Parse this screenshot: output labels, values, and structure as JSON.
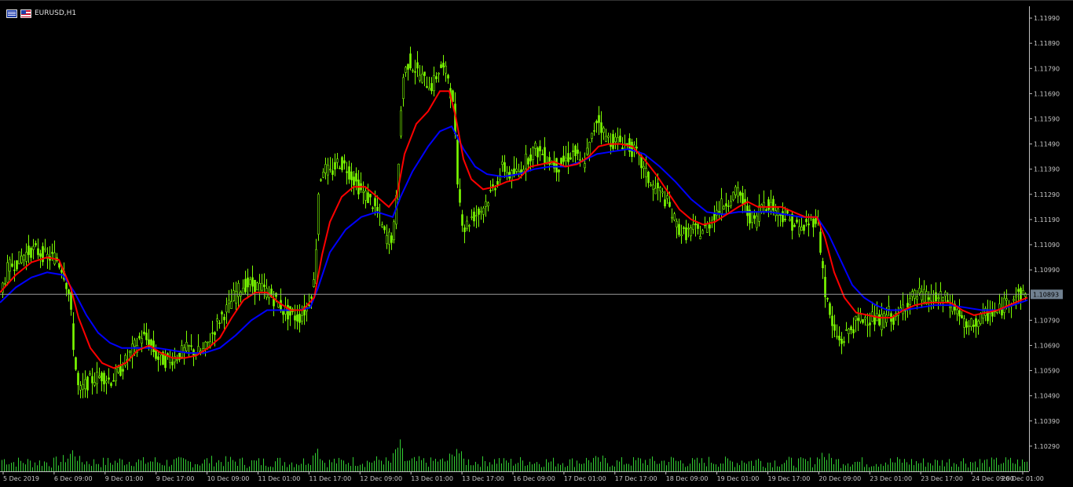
{
  "window": {
    "title": "EURUSD,H1"
  },
  "colors": {
    "background": "#000000",
    "candle": "#7CFC00",
    "ma_fast": "#FF0000",
    "ma_slow": "#0000FF",
    "volume": "#32CD32",
    "grid_line": "#C0C0C0",
    "price_tag": "#708090"
  },
  "chart_data": {
    "type": "candlestick",
    "symbol": "EURUSD",
    "timeframe": "H1",
    "ylim": [
      1.1019,
      1.1204
    ],
    "y_ticks": [
      "1.11990",
      "1.11890",
      "1.11790",
      "1.11690",
      "1.11590",
      "1.11490",
      "1.11390",
      "1.11290",
      "1.11190",
      "1.11090",
      "1.10990",
      "1.10790",
      "1.10690",
      "1.10590",
      "1.10490",
      "1.10390",
      "1.10290"
    ],
    "x_ticks": [
      "5 Dec 2019",
      "6 Dec 09:00",
      "9 Dec 01:00",
      "9 Dec 17:00",
      "10 Dec 09:00",
      "11 Dec 01:00",
      "11 Dec 17:00",
      "12 Dec 09:00",
      "13 Dec 01:00",
      "13 Dec 17:00",
      "16 Dec 09:00",
      "17 Dec 01:00",
      "17 Dec 17:00",
      "18 Dec 09:00",
      "19 Dec 01:00",
      "19 Dec 17:00",
      "20 Dec 09:00",
      "23 Dec 01:00",
      "23 Dec 17:00",
      "24 Dec 09:00",
      "26 Dec 01:00"
    ],
    "current_price": "1.10893",
    "current_price_value": 1.10893,
    "close_path": [
      [
        0,
        1.109
      ],
      [
        10,
        1.11
      ],
      [
        20,
        1.1102
      ],
      [
        30,
        1.1105
      ],
      [
        40,
        1.1107
      ],
      [
        50,
        1.1106
      ],
      [
        60,
        1.1104
      ],
      [
        70,
        1.1104
      ],
      [
        80,
        1.1099
      ],
      [
        88,
        1.1088
      ],
      [
        95,
        1.1062
      ],
      [
        100,
        1.105
      ],
      [
        110,
        1.1054
      ],
      [
        120,
        1.1056
      ],
      [
        130,
        1.1057
      ],
      [
        140,
        1.1055
      ],
      [
        150,
        1.1058
      ],
      [
        160,
        1.1063
      ],
      [
        170,
        1.1068
      ],
      [
        180,
        1.1073
      ],
      [
        190,
        1.107
      ],
      [
        200,
        1.1064
      ],
      [
        210,
        1.1063
      ],
      [
        220,
        1.1064
      ],
      [
        230,
        1.1066
      ],
      [
        240,
        1.1068
      ],
      [
        250,
        1.1066
      ],
      [
        260,
        1.1067
      ],
      [
        270,
        1.1074
      ],
      [
        280,
        1.108
      ],
      [
        290,
        1.1084
      ],
      [
        300,
        1.109
      ],
      [
        310,
        1.1093
      ],
      [
        320,
        1.1093
      ],
      [
        330,
        1.1092
      ],
      [
        340,
        1.109
      ],
      [
        350,
        1.1087
      ],
      [
        360,
        1.1083
      ],
      [
        370,
        1.1081
      ],
      [
        380,
        1.108
      ],
      [
        390,
        1.1084
      ],
      [
        400,
        1.1095
      ],
      [
        405,
        1.113
      ],
      [
        410,
        1.114
      ],
      [
        420,
        1.1137
      ],
      [
        430,
        1.1142
      ],
      [
        440,
        1.114
      ],
      [
        450,
        1.1135
      ],
      [
        460,
        1.113
      ],
      [
        470,
        1.1127
      ],
      [
        480,
        1.1122
      ],
      [
        490,
        1.1112
      ],
      [
        500,
        1.1112
      ],
      [
        505,
        1.113
      ],
      [
        512,
        1.1175
      ],
      [
        520,
        1.1182
      ],
      [
        530,
        1.1178
      ],
      [
        540,
        1.1174
      ],
      [
        550,
        1.1172
      ],
      [
        560,
        1.118
      ],
      [
        570,
        1.1176
      ],
      [
        578,
        1.116
      ],
      [
        583,
        1.113
      ],
      [
        590,
        1.1115
      ],
      [
        600,
        1.112
      ],
      [
        610,
        1.1122
      ],
      [
        620,
        1.1127
      ],
      [
        630,
        1.1133
      ],
      [
        640,
        1.114
      ],
      [
        650,
        1.1136
      ],
      [
        660,
        1.1138
      ],
      [
        670,
        1.1143
      ],
      [
        680,
        1.1147
      ],
      [
        690,
        1.1145
      ],
      [
        700,
        1.1142
      ],
      [
        710,
        1.114
      ],
      [
        720,
        1.1143
      ],
      [
        730,
        1.1146
      ],
      [
        740,
        1.114
      ],
      [
        750,
        1.1148
      ],
      [
        760,
        1.116
      ],
      [
        770,
        1.1152
      ],
      [
        780,
        1.115
      ],
      [
        790,
        1.115
      ],
      [
        800,
        1.1148
      ],
      [
        810,
        1.1145
      ],
      [
        820,
        1.1138
      ],
      [
        830,
        1.1132
      ],
      [
        840,
        1.113
      ],
      [
        850,
        1.1125
      ],
      [
        860,
        1.1117
      ],
      [
        870,
        1.1113
      ],
      [
        880,
        1.1115
      ],
      [
        890,
        1.1114
      ],
      [
        900,
        1.1116
      ],
      [
        910,
        1.1122
      ],
      [
        920,
        1.1125
      ],
      [
        930,
        1.1128
      ],
      [
        940,
        1.113
      ],
      [
        950,
        1.1122
      ],
      [
        960,
        1.1118
      ],
      [
        970,
        1.1126
      ],
      [
        980,
        1.1125
      ],
      [
        990,
        1.1122
      ],
      [
        1000,
        1.112
      ],
      [
        1010,
        1.1117
      ],
      [
        1020,
        1.1115
      ],
      [
        1030,
        1.1118
      ],
      [
        1040,
        1.112
      ],
      [
        1045,
        1.1105
      ],
      [
        1050,
        1.109
      ],
      [
        1060,
        1.1075
      ],
      [
        1070,
        1.107
      ],
      [
        1080,
        1.1075
      ],
      [
        1090,
        1.1078
      ],
      [
        1100,
        1.108
      ],
      [
        1110,
        1.108
      ],
      [
        1120,
        1.1078
      ],
      [
        1130,
        1.1082
      ],
      [
        1140,
        1.1079
      ],
      [
        1150,
        1.1085
      ],
      [
        1160,
        1.1088
      ],
      [
        1170,
        1.1089
      ],
      [
        1180,
        1.1088
      ],
      [
        1190,
        1.1087
      ],
      [
        1200,
        1.1088
      ],
      [
        1210,
        1.1085
      ],
      [
        1220,
        1.1082
      ],
      [
        1230,
        1.1075
      ],
      [
        1240,
        1.1078
      ],
      [
        1250,
        1.108
      ],
      [
        1260,
        1.1082
      ],
      [
        1270,
        1.1082
      ],
      [
        1280,
        1.1086
      ],
      [
        1290,
        1.1089
      ],
      [
        1300,
        1.1089
      ],
      [
        1308,
        1.1089
      ]
    ],
    "ma_fast_path": [
      [
        0,
        1.109
      ],
      [
        20,
        1.1097
      ],
      [
        40,
        1.1102
      ],
      [
        60,
        1.1104
      ],
      [
        75,
        1.1103
      ],
      [
        90,
        1.1092
      ],
      [
        100,
        1.108
      ],
      [
        115,
        1.1068
      ],
      [
        130,
        1.1062
      ],
      [
        145,
        1.106
      ],
      [
        160,
        1.1062
      ],
      [
        175,
        1.1067
      ],
      [
        190,
        1.1069
      ],
      [
        205,
        1.1066
      ],
      [
        220,
        1.1064
      ],
      [
        235,
        1.1064
      ],
      [
        250,
        1.1065
      ],
      [
        265,
        1.1068
      ],
      [
        280,
        1.1072
      ],
      [
        295,
        1.108
      ],
      [
        310,
        1.1087
      ],
      [
        325,
        1.109
      ],
      [
        340,
        1.109
      ],
      [
        355,
        1.1086
      ],
      [
        370,
        1.1083
      ],
      [
        385,
        1.1083
      ],
      [
        400,
        1.1088
      ],
      [
        410,
        1.1105
      ],
      [
        420,
        1.1118
      ],
      [
        435,
        1.1128
      ],
      [
        450,
        1.1132
      ],
      [
        465,
        1.1132
      ],
      [
        480,
        1.1128
      ],
      [
        495,
        1.1124
      ],
      [
        505,
        1.1128
      ],
      [
        515,
        1.1145
      ],
      [
        530,
        1.1157
      ],
      [
        545,
        1.1162
      ],
      [
        560,
        1.117
      ],
      [
        572,
        1.117
      ],
      [
        580,
        1.116
      ],
      [
        590,
        1.1143
      ],
      [
        600,
        1.1135
      ],
      [
        615,
        1.1131
      ],
      [
        630,
        1.1132
      ],
      [
        645,
        1.1134
      ],
      [
        660,
        1.1135
      ],
      [
        675,
        1.114
      ],
      [
        690,
        1.1141
      ],
      [
        705,
        1.1142
      ],
      [
        720,
        1.114
      ],
      [
        735,
        1.1141
      ],
      [
        750,
        1.1144
      ],
      [
        762,
        1.1148
      ],
      [
        775,
        1.1149
      ],
      [
        790,
        1.1149
      ],
      [
        805,
        1.1148
      ],
      [
        820,
        1.1143
      ],
      [
        835,
        1.1137
      ],
      [
        850,
        1.113
      ],
      [
        865,
        1.1123
      ],
      [
        880,
        1.1119
      ],
      [
        895,
        1.1117
      ],
      [
        910,
        1.1118
      ],
      [
        925,
        1.1121
      ],
      [
        940,
        1.1124
      ],
      [
        952,
        1.1126
      ],
      [
        965,
        1.1124
      ],
      [
        980,
        1.1124
      ],
      [
        995,
        1.1124
      ],
      [
        1010,
        1.1122
      ],
      [
        1025,
        1.112
      ],
      [
        1040,
        1.112
      ],
      [
        1050,
        1.1112
      ],
      [
        1062,
        1.1098
      ],
      [
        1075,
        1.1088
      ],
      [
        1090,
        1.1082
      ],
      [
        1105,
        1.1081
      ],
      [
        1120,
        1.108
      ],
      [
        1135,
        1.108
      ],
      [
        1150,
        1.1083
      ],
      [
        1165,
        1.1085
      ],
      [
        1180,
        1.1086
      ],
      [
        1195,
        1.1086
      ],
      [
        1210,
        1.1086
      ],
      [
        1225,
        1.1083
      ],
      [
        1240,
        1.1081
      ],
      [
        1255,
        1.1082
      ],
      [
        1270,
        1.1083
      ],
      [
        1285,
        1.1085
      ],
      [
        1300,
        1.1087
      ],
      [
        1308,
        1.1088
      ]
    ],
    "ma_slow_path": [
      [
        0,
        1.1086
      ],
      [
        20,
        1.1092
      ],
      [
        40,
        1.1096
      ],
      [
        60,
        1.1098
      ],
      [
        80,
        1.1097
      ],
      [
        95,
        1.109
      ],
      [
        110,
        1.1081
      ],
      [
        125,
        1.1074
      ],
      [
        140,
        1.107
      ],
      [
        155,
        1.1068
      ],
      [
        170,
        1.1068
      ],
      [
        185,
        1.1068
      ],
      [
        200,
        1.1068
      ],
      [
        220,
        1.1067
      ],
      [
        240,
        1.1066
      ],
      [
        260,
        1.1066
      ],
      [
        280,
        1.1068
      ],
      [
        300,
        1.1073
      ],
      [
        320,
        1.1079
      ],
      [
        340,
        1.1083
      ],
      [
        360,
        1.1083
      ],
      [
        380,
        1.1083
      ],
      [
        395,
        1.1084
      ],
      [
        405,
        1.1092
      ],
      [
        420,
        1.1106
      ],
      [
        440,
        1.1115
      ],
      [
        460,
        1.112
      ],
      [
        480,
        1.1122
      ],
      [
        500,
        1.112
      ],
      [
        510,
        1.1128
      ],
      [
        525,
        1.1138
      ],
      [
        545,
        1.1148
      ],
      [
        560,
        1.1154
      ],
      [
        575,
        1.1156
      ],
      [
        590,
        1.1147
      ],
      [
        605,
        1.114
      ],
      [
        620,
        1.1137
      ],
      [
        640,
        1.1136
      ],
      [
        660,
        1.1137
      ],
      [
        680,
        1.1139
      ],
      [
        700,
        1.114
      ],
      [
        720,
        1.114
      ],
      [
        740,
        1.1142
      ],
      [
        760,
        1.1145
      ],
      [
        780,
        1.1146
      ],
      [
        800,
        1.1147
      ],
      [
        820,
        1.1145
      ],
      [
        840,
        1.114
      ],
      [
        860,
        1.1134
      ],
      [
        880,
        1.1127
      ],
      [
        900,
        1.1122
      ],
      [
        920,
        1.1121
      ],
      [
        940,
        1.1122
      ],
      [
        960,
        1.1122
      ],
      [
        980,
        1.1122
      ],
      [
        1000,
        1.1121
      ],
      [
        1020,
        1.112
      ],
      [
        1040,
        1.112
      ],
      [
        1055,
        1.1113
      ],
      [
        1070,
        1.1103
      ],
      [
        1085,
        1.1093
      ],
      [
        1100,
        1.1088
      ],
      [
        1115,
        1.1085
      ],
      [
        1130,
        1.1083
      ],
      [
        1150,
        1.1083
      ],
      [
        1170,
        1.1084
      ],
      [
        1190,
        1.1085
      ],
      [
        1210,
        1.1085
      ],
      [
        1230,
        1.1084
      ],
      [
        1250,
        1.1083
      ],
      [
        1270,
        1.1083
      ],
      [
        1290,
        1.1085
      ],
      [
        1308,
        1.1087
      ]
    ]
  }
}
